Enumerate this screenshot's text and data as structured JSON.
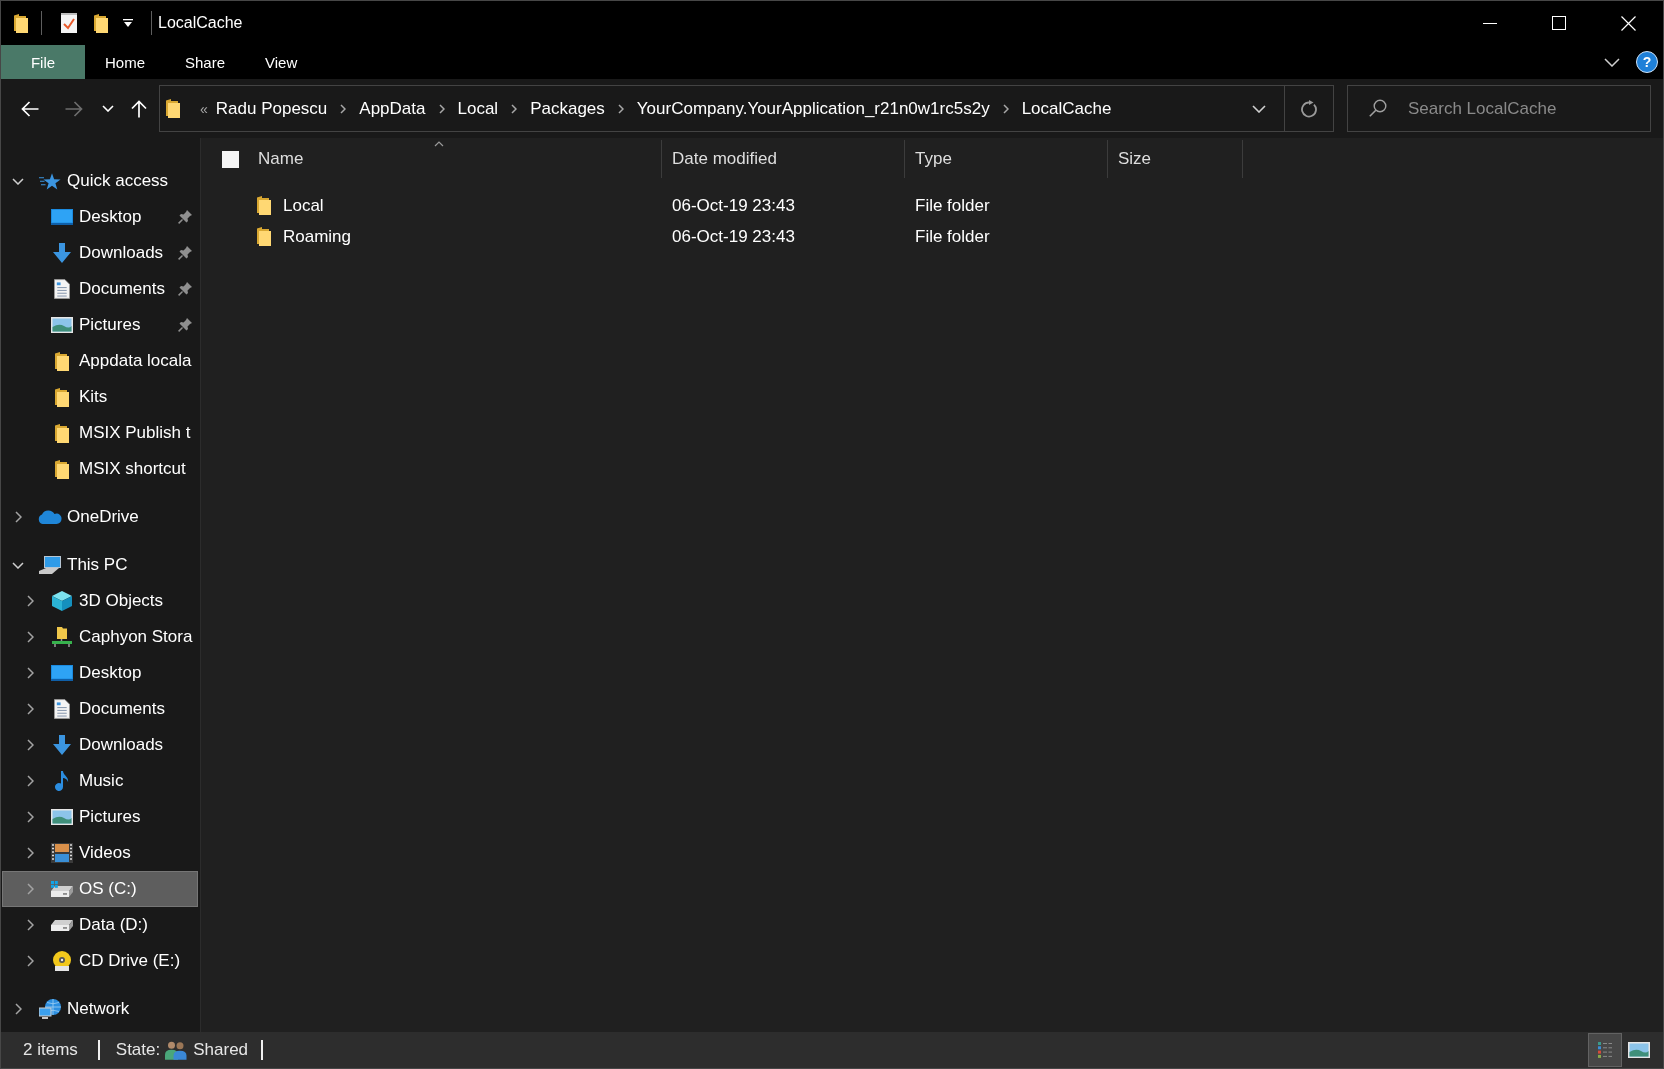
{
  "window": {
    "title": "LocalCache"
  },
  "ribbon": {
    "tabs": [
      {
        "label": "File",
        "kind": "file",
        "selected": false
      },
      {
        "label": "Home",
        "kind": "tab",
        "selected": false
      },
      {
        "label": "Share",
        "kind": "tab",
        "selected": false
      },
      {
        "label": "View",
        "kind": "tab",
        "selected": false
      }
    ],
    "help": "?"
  },
  "navigation": [
    {
      "kind": "back",
      "disabled": false
    },
    {
      "kind": "forward",
      "disabled": true
    },
    {
      "kind": "recent",
      "disabled": false
    },
    {
      "kind": "up",
      "disabled": false
    }
  ],
  "address_bar": {
    "overflow": "«",
    "path": [
      "Radu Popescu",
      "AppData",
      "Local",
      "Packages",
      "YourCompany.YourApplication_r21n0w1rc5s2y",
      "LocalCache"
    ]
  },
  "search": {
    "placeholder": "Search LocalCache"
  },
  "sidebar": {
    "items": [
      {
        "label": "Quick access",
        "kind": "quick_access",
        "expanded": true,
        "selected": false,
        "children": [
          {
            "label": "Desktop",
            "kind": "desktop",
            "pinned": true,
            "selected": false
          },
          {
            "label": "Downloads",
            "kind": "downloads",
            "pinned": true,
            "selected": false
          },
          {
            "label": "Documents",
            "kind": "documents",
            "pinned": true,
            "selected": false
          },
          {
            "label": "Pictures",
            "kind": "pictures",
            "pinned": true,
            "selected": false
          },
          {
            "label": "Appdata locala",
            "kind": "folder",
            "pinned": false,
            "selected": false
          },
          {
            "label": "Kits",
            "kind": "folder",
            "pinned": false,
            "selected": false
          },
          {
            "label": "MSIX Publish t",
            "kind": "folder",
            "pinned": false,
            "selected": false
          },
          {
            "label": "MSIX shortcut",
            "kind": "folder",
            "pinned": false,
            "selected": false
          }
        ]
      },
      {
        "label": "OneDrive",
        "kind": "onedrive",
        "expanded": false,
        "selected": false
      },
      {
        "label": "This PC",
        "kind": "this_pc",
        "expanded": true,
        "selected": false,
        "children": [
          {
            "label": "3D Objects",
            "kind": "objects_3d",
            "expanded": false,
            "selected": false
          },
          {
            "label": "Caphyon Stora",
            "kind": "network_folder",
            "expanded": false,
            "selected": false
          },
          {
            "label": "Desktop",
            "kind": "desktop",
            "expanded": false,
            "selected": false
          },
          {
            "label": "Documents",
            "kind": "documents",
            "expanded": false,
            "selected": false
          },
          {
            "label": "Downloads",
            "kind": "downloads",
            "expanded": false,
            "selected": false
          },
          {
            "label": "Music",
            "kind": "music",
            "expanded": false,
            "selected": false
          },
          {
            "label": "Pictures",
            "kind": "pictures",
            "expanded": false,
            "selected": false
          },
          {
            "label": "Videos",
            "kind": "videos",
            "expanded": false,
            "selected": false
          },
          {
            "label": "OS (C:)",
            "kind": "system_drive",
            "expanded": false,
            "selected": true
          },
          {
            "label": "Data (D:)",
            "kind": "drive",
            "expanded": false,
            "selected": false
          },
          {
            "label": "CD Drive (E:)",
            "kind": "cd_drive",
            "expanded": false,
            "selected": false
          }
        ]
      },
      {
        "label": "Network",
        "kind": "network",
        "expanded": false,
        "selected": false
      }
    ]
  },
  "file_list": {
    "select_all": {
      "checked": false
    },
    "columns": [
      {
        "label": "Name",
        "sorted": true
      },
      {
        "label": "Date modified",
        "sorted": false
      },
      {
        "label": "Type",
        "sorted": false
      },
      {
        "label": "Size",
        "sorted": false
      }
    ],
    "rows": [
      {
        "name": "Local",
        "date_modified": "06-Oct-19 23:43",
        "type": "File folder",
        "selected": false
      },
      {
        "name": "Roaming",
        "date_modified": "06-Oct-19 23:43",
        "type": "File folder",
        "selected": false
      }
    ]
  },
  "status_bar": {
    "item_count": "2 items",
    "state_label": "State:",
    "state_value": "Shared",
    "views": [
      {
        "kind": "details",
        "selected": true
      },
      {
        "kind": "large_icons",
        "selected": false
      }
    ]
  }
}
